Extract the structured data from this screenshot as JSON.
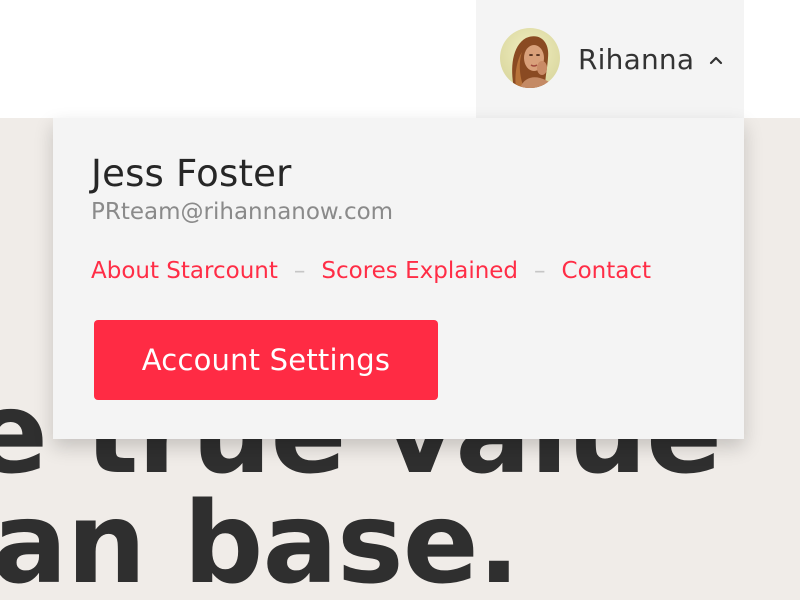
{
  "header": {
    "account": {
      "name": "Rihanna",
      "expanded": true
    }
  },
  "hero": {
    "line1": "e true value",
    "line2": "an base."
  },
  "dropdown": {
    "user_name": "Jess Foster",
    "user_email": "PRteam@rihannanow.com",
    "links": [
      {
        "label": "About Starcount"
      },
      {
        "label": "Scores Explained"
      },
      {
        "label": "Contact"
      }
    ],
    "separator": "–",
    "cta_label": "Account Settings"
  },
  "colors": {
    "accent": "#ff2b44",
    "link": "#ff2d46",
    "panel_bg": "#f4f4f4",
    "page_bg": "#f0ece8",
    "header_bg": "#ffffff",
    "text_dark": "#262626",
    "text_muted": "#8a8a8a"
  }
}
